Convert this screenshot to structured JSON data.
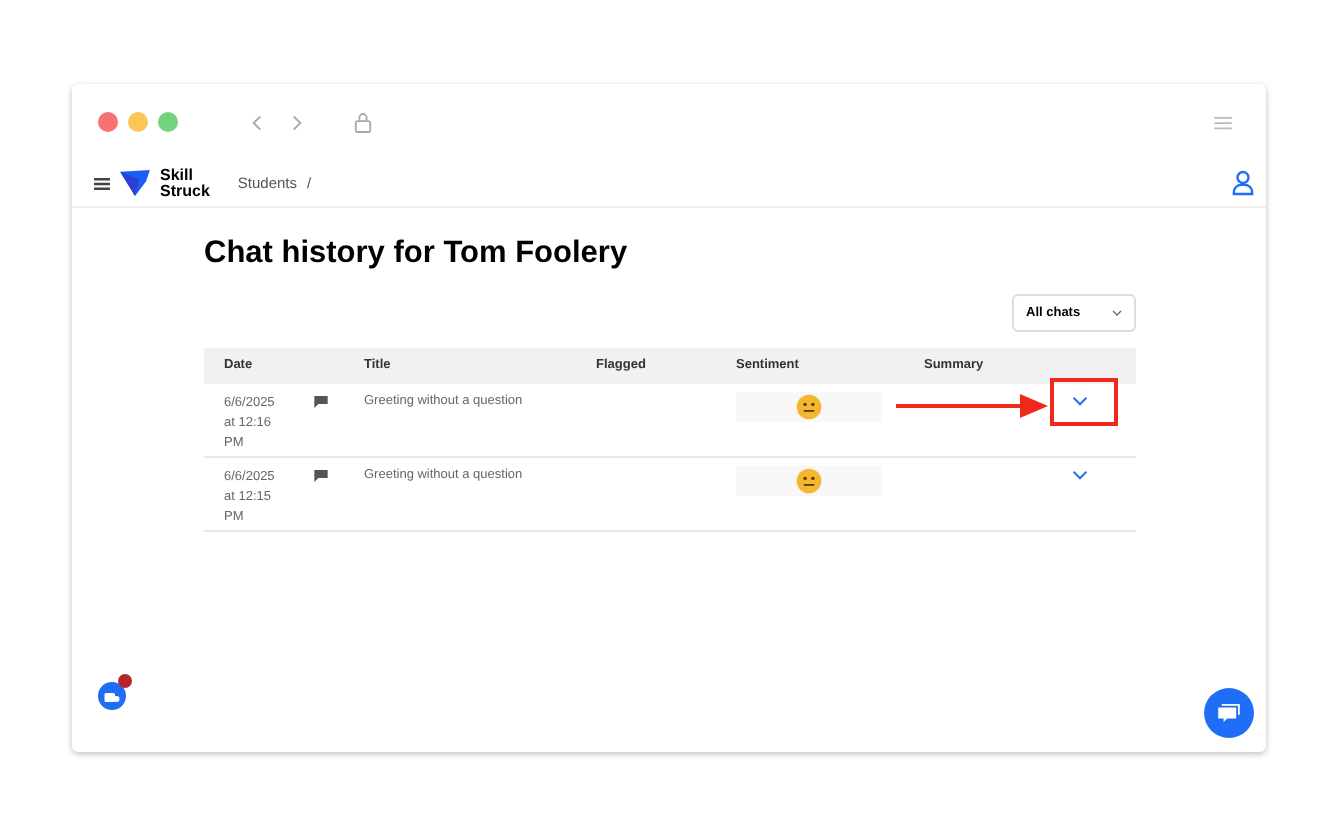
{
  "brand": {
    "name_line_1": "Skill",
    "name_line_2": "Struck"
  },
  "breadcrumb": [
    "Students",
    "/"
  ],
  "title": "Chat history for Tom Foolery",
  "filter": {
    "value": "All chats"
  },
  "table": {
    "columns": [
      "Date",
      "",
      "Title",
      "Flagged",
      "Sentiment",
      "Summary"
    ],
    "rows": [
      {
        "date": "6/6/2025 at 12:16 PM",
        "title": "Greeting without a question",
        "highlighted": true
      },
      {
        "date": "6/6/2025 at 12:15 PM",
        "title": "Greeting without a question",
        "highlighted": false
      }
    ]
  }
}
